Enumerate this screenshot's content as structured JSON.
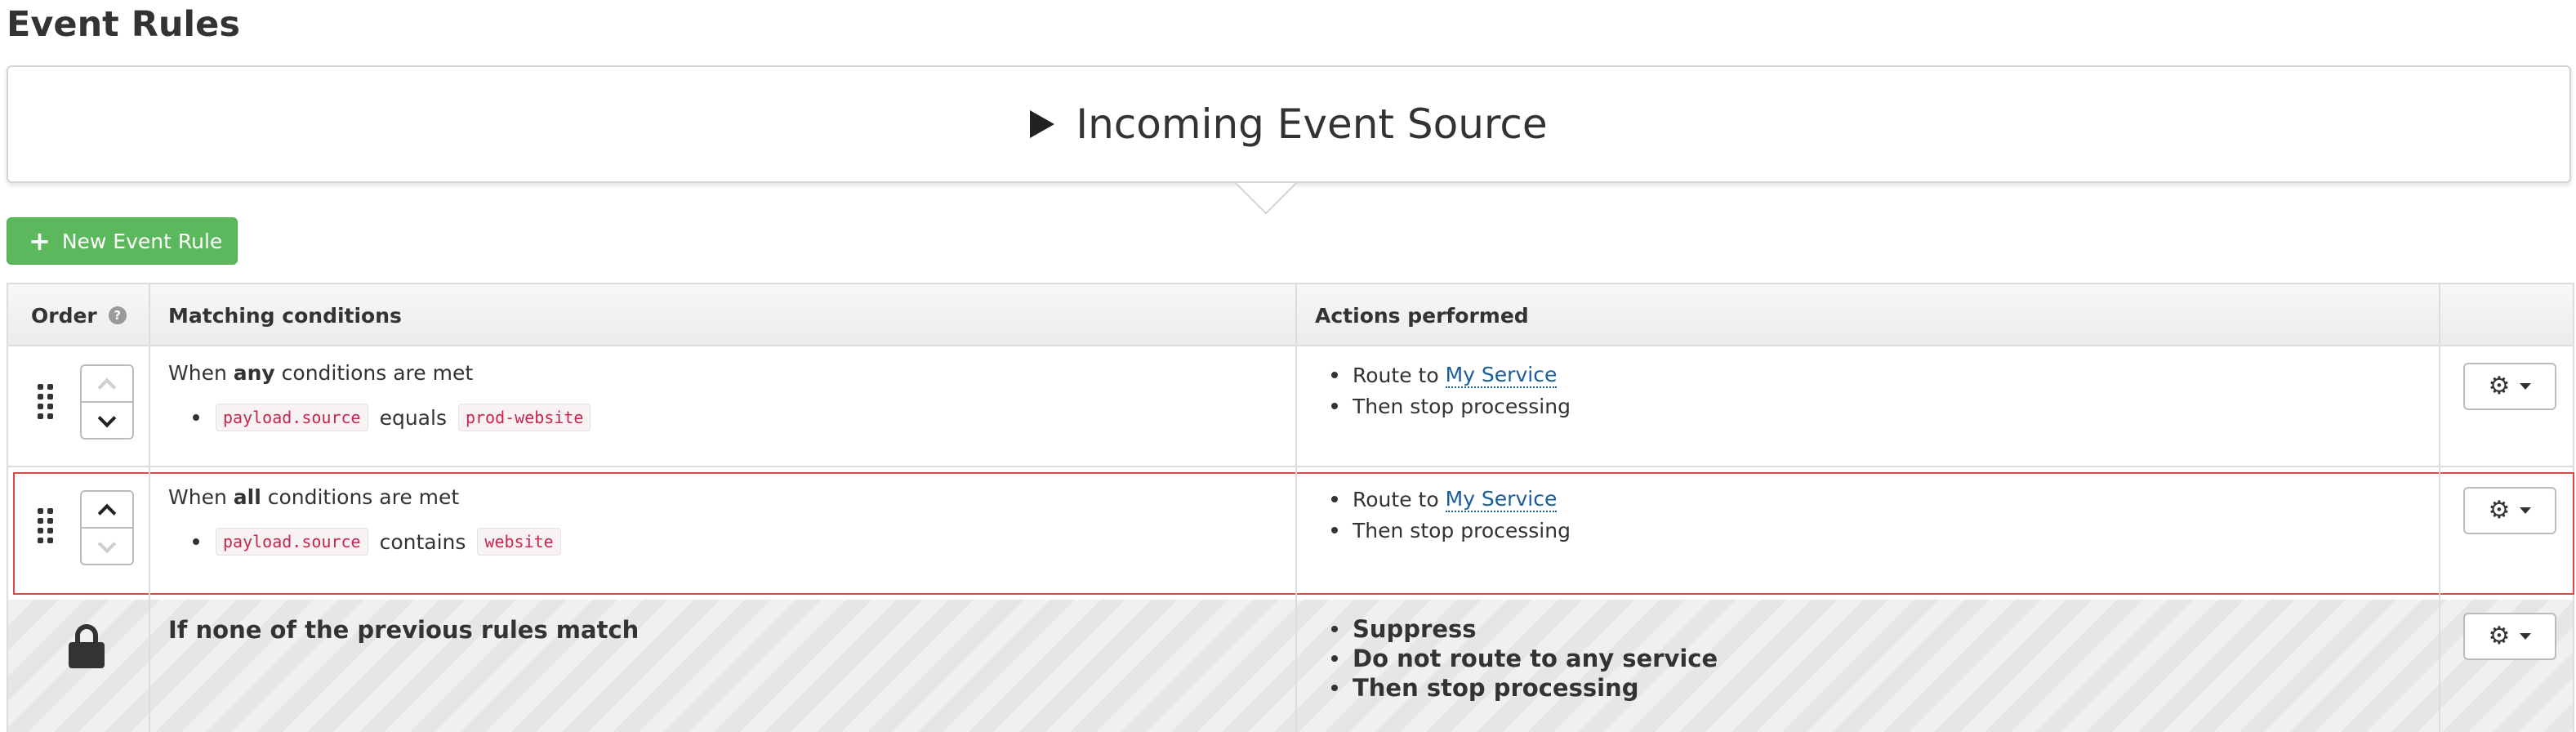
{
  "page": {
    "title": "Event Rules"
  },
  "source": {
    "title": "Incoming Event Source"
  },
  "new_rule_button": {
    "label": "New Event Rule"
  },
  "table": {
    "headers": {
      "order": "Order",
      "conditions": "Matching conditions",
      "actions": "Actions performed"
    }
  },
  "rules": [
    {
      "condition_prefix": "When ",
      "condition_mode": "any",
      "condition_suffix": " conditions are met",
      "condition": {
        "field": "payload.source",
        "operator": "equals",
        "value": "prod-website"
      },
      "actions": {
        "route_prefix": "Route to",
        "service": "My Service",
        "stop": "Then stop processing"
      },
      "can_move_up": false,
      "can_move_down": true
    },
    {
      "condition_prefix": "When ",
      "condition_mode": "all",
      "condition_suffix": " conditions are met",
      "condition": {
        "field": "payload.source",
        "operator": "contains",
        "value": "website"
      },
      "actions": {
        "route_prefix": "Route to",
        "service": "My Service",
        "stop": "Then stop processing"
      },
      "can_move_up": true,
      "can_move_down": false,
      "highlighted": true
    }
  ],
  "fallback": {
    "title": "If none of the previous rules match",
    "actions": [
      "Suppress",
      "Do not route to any service",
      "Then stop processing"
    ]
  },
  "colors": {
    "primary_button": "#5cb85c",
    "highlight_border": "#e04848",
    "link": "#1a5d9a",
    "code_text": "#c7254e"
  },
  "icons": {
    "source": "play-icon",
    "add": "plus-icon",
    "help": "help-icon",
    "drag": "drag-handle-icon",
    "up": "chevron-up-icon",
    "down": "chevron-down-icon",
    "settings": "gear-icon",
    "locked": "lock-icon"
  }
}
